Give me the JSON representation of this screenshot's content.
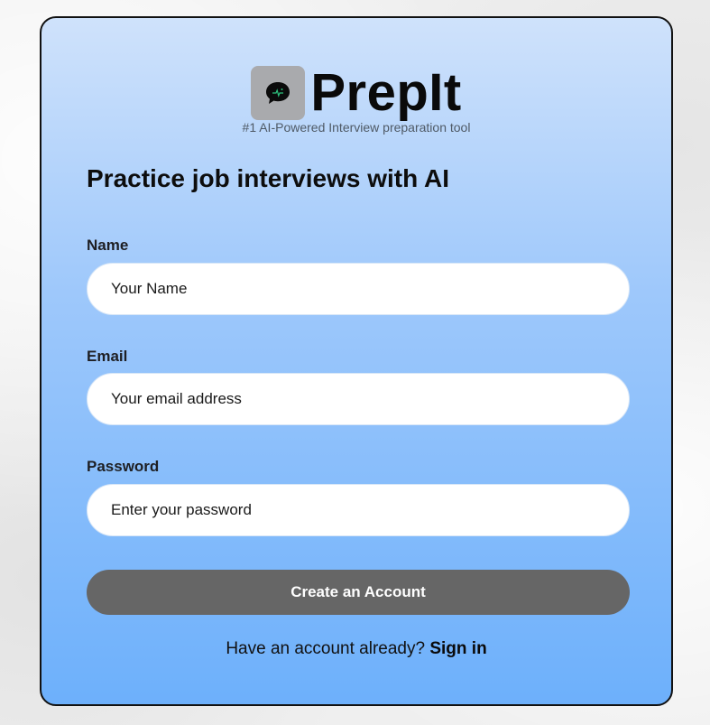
{
  "brand": {
    "name": "PrepIt",
    "tagline": "#1 AI-Powered Interview preparation tool",
    "logo_icon": "chat-bubble-icon"
  },
  "headline": "Practice job interviews with AI",
  "form": {
    "name": {
      "label": "Name",
      "placeholder": "Your Name"
    },
    "email": {
      "label": "Email",
      "placeholder": "Your email address"
    },
    "password": {
      "label": "Password",
      "placeholder": "Enter your password"
    },
    "submit_label": "Create an Account"
  },
  "signin": {
    "prompt": "Have an account already?",
    "link_label": "Sign in"
  },
  "colors": {
    "card_top": "#cfe2fb",
    "card_bottom": "#6db0fb",
    "button": "#666666",
    "logo_bg": "#a9aaad"
  }
}
